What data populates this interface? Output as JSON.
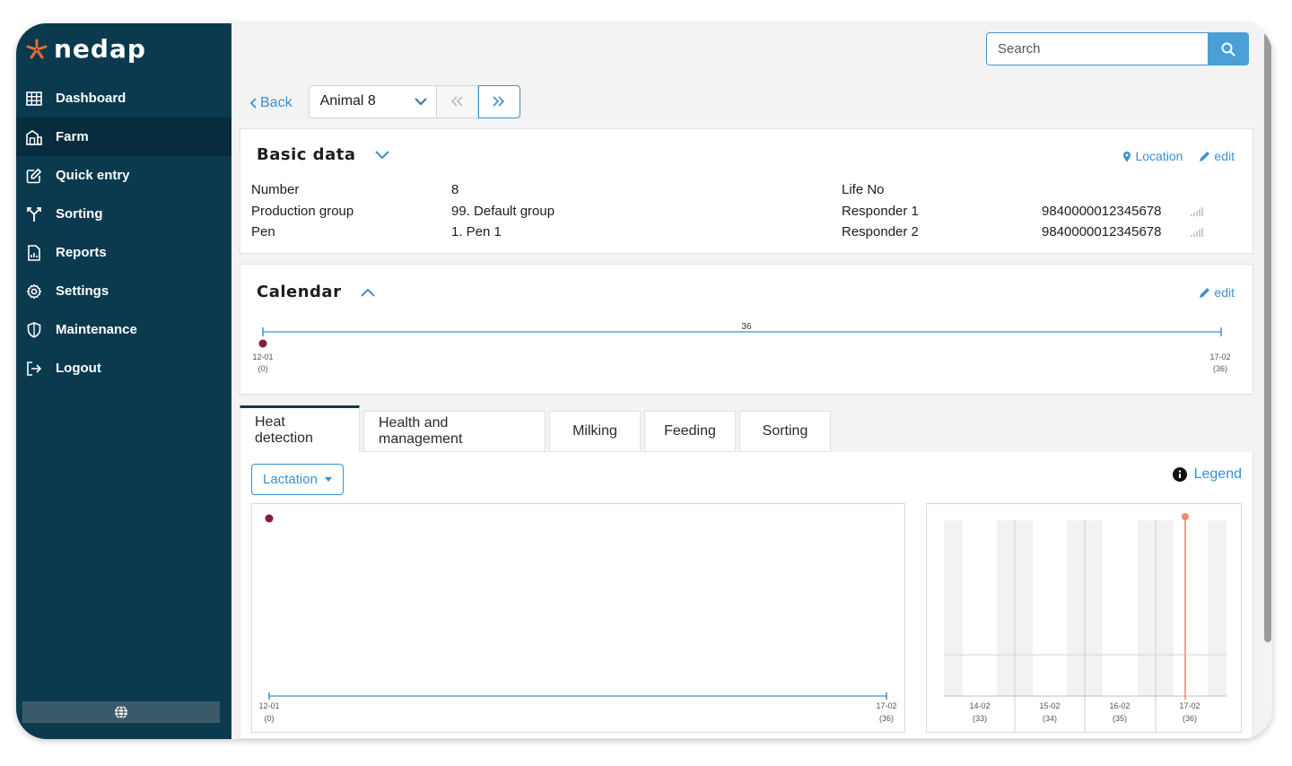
{
  "brand": {
    "name": "nedap",
    "accent": "#f26a32",
    "sidebar_bg": "#0b3a4f"
  },
  "sidebar": {
    "items": [
      {
        "label": "Dashboard",
        "icon": "grid-icon"
      },
      {
        "label": "Farm",
        "icon": "farm-icon",
        "active": true
      },
      {
        "label": "Quick entry",
        "icon": "edit-icon"
      },
      {
        "label": "Sorting",
        "icon": "fork-icon"
      },
      {
        "label": "Reports",
        "icon": "report-icon"
      },
      {
        "label": "Settings",
        "icon": "gear-icon"
      },
      {
        "label": "Maintenance",
        "icon": "shield-icon"
      },
      {
        "label": "Logout",
        "icon": "logout-icon"
      }
    ],
    "footer_icon": "globe-icon"
  },
  "search": {
    "placeholder": "Search"
  },
  "toolbar": {
    "back_label": "Back",
    "animal_selected": "Animal 8"
  },
  "basic_data": {
    "title": "Basic data",
    "location_label": "Location",
    "edit_label": "edit",
    "fields_left": [
      {
        "label": "Number",
        "value": "8"
      },
      {
        "label": "Production group",
        "value": "99. Default group"
      },
      {
        "label": "Pen",
        "value": "1. Pen 1"
      }
    ],
    "fields_right": [
      {
        "label": "Life No",
        "value": ""
      },
      {
        "label": "Responder 1",
        "value": "9840000012345678"
      },
      {
        "label": "Responder 2",
        "value": "9840000012345678"
      }
    ]
  },
  "calendar": {
    "title": "Calendar",
    "edit_label": "edit",
    "span_label": "36",
    "start": {
      "date": "12-01",
      "day": "(0)"
    },
    "end": {
      "date": "17-02",
      "day": "(36)"
    },
    "event_color": "#8b1a3f"
  },
  "tabs": [
    {
      "label": "Heat detection",
      "active": true
    },
    {
      "label": "Health and management"
    },
    {
      "label": "Milking"
    },
    {
      "label": "Feeding"
    },
    {
      "label": "Sorting"
    }
  ],
  "heat_panel": {
    "lactation_label": "Lactation",
    "legend_label": "Legend",
    "main_chart": {
      "start": {
        "date": "12-01",
        "day": "(0)"
      },
      "end": {
        "date": "17-02",
        "day": "(36)"
      }
    },
    "side_chart": {
      "days": [
        {
          "date": "14-02",
          "day": "(33)"
        },
        {
          "date": "15-02",
          "day": "(34)"
        },
        {
          "date": "16-02",
          "day": "(35)"
        },
        {
          "date": "17-02",
          "day": "(36)"
        }
      ],
      "marker_color": "#f28a6a"
    }
  }
}
